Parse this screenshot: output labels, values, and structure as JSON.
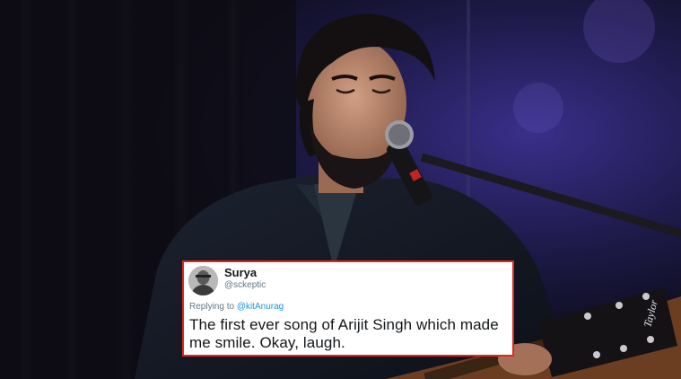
{
  "tweet": {
    "display_name": "Surya",
    "handle": "@sckeptic",
    "replying_prefix": "Replying to ",
    "replying_to": "@kitAnurag",
    "text": "The first ever song of Arijit Singh which made me smile. Okay, laugh."
  },
  "background": {
    "guitar_brand": "Taylor"
  },
  "colors": {
    "card_border": "#e0271d",
    "mention": "#1b95e0",
    "name": "#14171a",
    "meta": "#657786"
  }
}
